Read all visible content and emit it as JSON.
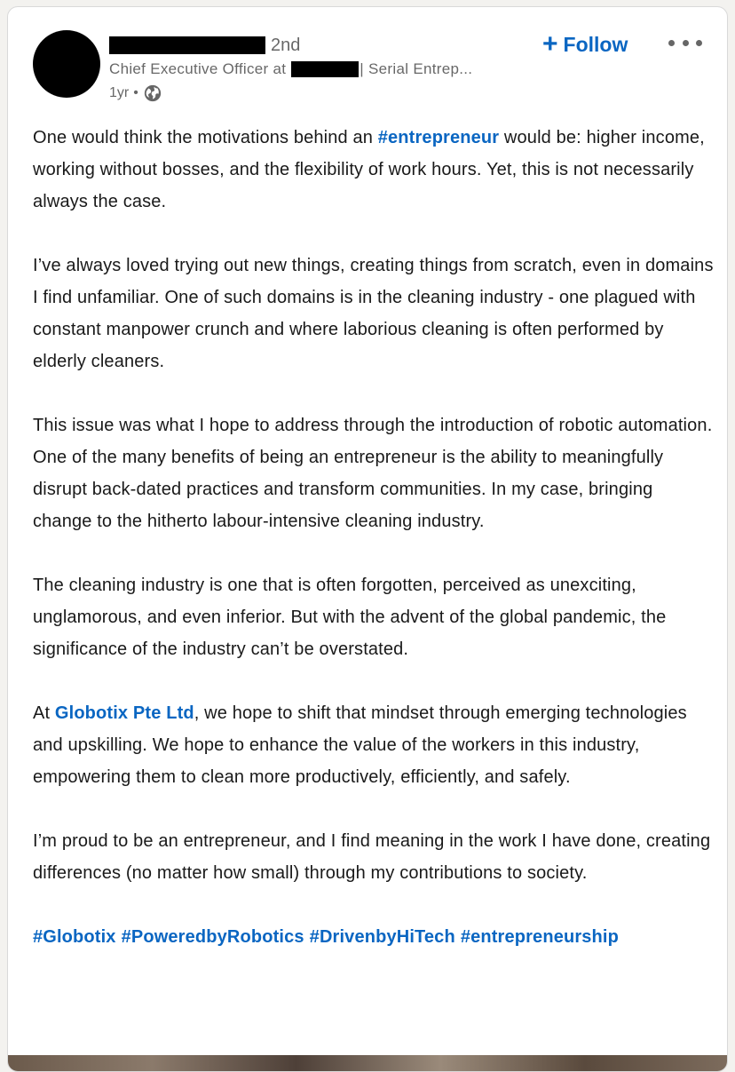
{
  "author": {
    "degree": "2nd",
    "headline_prefix": "Chief Executive Officer at",
    "headline_suffix": "| Serial Entrep...",
    "time": "1yr",
    "dot": "•"
  },
  "actions": {
    "follow_plus": "+",
    "follow_label": "Follow"
  },
  "post": {
    "p1_a": "One would think the motivations behind an ",
    "p1_tag": "#entrepreneur",
    "p1_b": " would be: higher income, working without bosses, and the flexibility of work hours. Yet, this is not necessarily always the case.",
    "p2": "I’ve always loved trying out new things, creating things from scratch, even in domains I find unfamiliar. One of such domains is in the cleaning industry - one plagued with constant manpower crunch and where laborious cleaning is often performed by elderly cleaners.",
    "p3": "This issue was what I hope to address through the introduction of robotic automation. One of the many benefits of being an entrepreneur is the ability to meaningfully disrupt back-dated practices and transform communities. In my case, bringing change to the hitherto labour-intensive cleaning industry.",
    "p4": "The cleaning industry is one that is often forgotten, perceived as unexciting, unglamorous, and even inferior. But with the advent of the global pandemic, the significance of the industry can’t be overstated.",
    "p5_a": "At ",
    "p5_link": "Globotix Pte Ltd",
    "p5_b": ", we hope to shift that mindset through emerging technologies and upskilling. We hope to enhance the value of the workers in this industry, empowering them to clean more productively, efficiently, and safely.",
    "p6": "I’m proud to be an entrepreneur, and I find meaning in the work I have done, creating differences (no matter how small) through my contributions to society.",
    "hashtags": [
      "#Globotix",
      "#PoweredbyRobotics",
      "#DrivenbyHiTech",
      "#entrepreneurship"
    ]
  },
  "colors": {
    "link": "#0a66c2",
    "secondary_text": "rgba(0,0,0,0.6)"
  },
  "icons": {
    "visibility": "globe-icon",
    "menu": "ellipsis-icon"
  }
}
